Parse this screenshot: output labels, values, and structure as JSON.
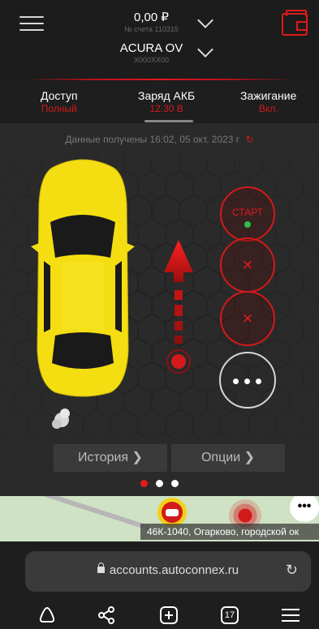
{
  "header": {
    "balance": "0,00 ₽",
    "account": "№ счета 110315",
    "car_name": "ACURA OV",
    "car_plate": "X000XX00"
  },
  "status": {
    "access_label": "Доступ",
    "access_value": "Полный",
    "battery_label": "Заряд АКБ",
    "battery_value": "12.30 В",
    "ignition_label": "Зажигание",
    "ignition_value": "Вкл."
  },
  "main": {
    "info": "Данные получены 16:02, 05 окт. 2023 г",
    "start_label": "СТАРТ",
    "history_label": "История",
    "options_label": "Опции",
    "page_count": 3,
    "active_page": 1
  },
  "map": {
    "address": "46К-1040, Огарково, городской ок"
  },
  "browser": {
    "url": "accounts.autoconnex.ru",
    "tabs_count": "17"
  },
  "colors": {
    "accent_red": "#e31a1a",
    "car_yellow": "#f4de12",
    "status_green": "#2ec04a"
  }
}
